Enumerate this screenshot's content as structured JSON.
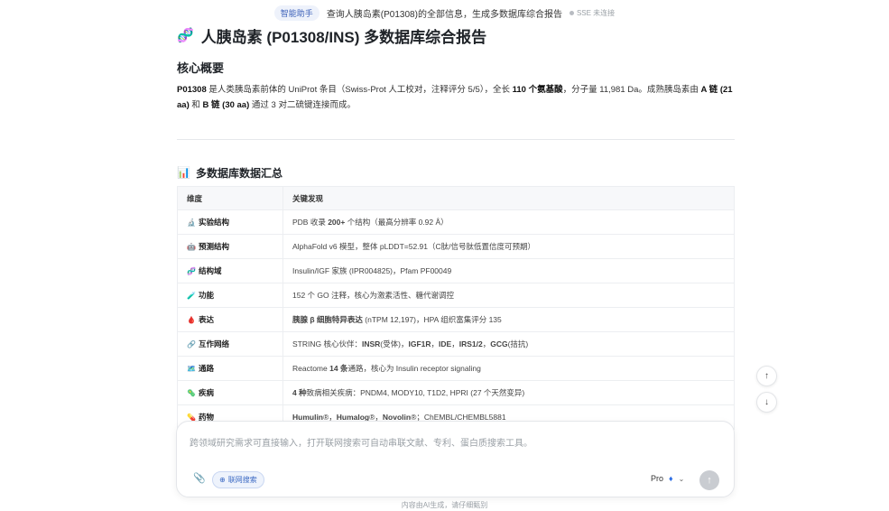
{
  "topbar": {
    "badge": "智能助手",
    "query": "查询人胰岛素(P01308)的全部信息，生成多数据库综合报告",
    "status": "SSE 未连接"
  },
  "report": {
    "title": "人胰岛素 (P01308/INS) 多数据库综合报告",
    "summary_heading": "核心概要",
    "summary": {
      "id": "P01308",
      "t1": " 是人类胰岛素前体的 UniProt 条目（Swiss-Prot 人工校对，注释评分 5/5），全长 ",
      "len": "110 个氨基酸",
      "t2": "，分子量 11,981 Da。成熟胰岛素由 ",
      "chainA": "A 链 (21 aa)",
      "t3": " 和 ",
      "chainB": "B 链 (30 aa)",
      "t4": " 通过 3 对二硫键连接而成。"
    },
    "table_heading": "多数据库数据汇总",
    "table": {
      "headers": [
        "维度",
        "关键发现"
      ],
      "rows": [
        {
          "icon": "🔬",
          "dim": "实验结构",
          "pre": "PDB 收录 ",
          "bold": "200+",
          "post": " 个结构（最高分辨率 0.92 Å）"
        },
        {
          "icon": "🤖",
          "dim": "预测结构",
          "pre": "AlphaFold v6 模型，整体 pLDDT=52.91（C肽/信号肽低置信度可预期）",
          "bold": "",
          "post": ""
        },
        {
          "icon": "🧬",
          "dim": "结构域",
          "pre": "Insulin/IGF 家族 (IPR004825)，Pfam PF00049",
          "bold": "",
          "post": ""
        },
        {
          "icon": "🧪",
          "dim": "功能",
          "pre": "152 个 GO 注释，核心为激素活性、糖代谢调控",
          "bold": "",
          "post": ""
        },
        {
          "icon": "🩸",
          "dim": "表达",
          "pre": "",
          "bold": "胰腺 β 细胞特异表达",
          "post": " (nTPM 12,197)，HPA 组织富集评分 135"
        },
        {
          "icon": "🔗",
          "dim": "互作网络",
          "pre": "STRING 核心伙伴：",
          "bold": "INSR",
          "post": "(受体)，",
          "bold2": "IGF1R",
          "mid2": "，",
          "bold3": "IDE",
          "mid3": "，",
          "bold4": "IRS1/2",
          "mid4": "，",
          "bold5": "GCG",
          "post2": "(拮抗)"
        },
        {
          "icon": "🗺️",
          "dim": "通路",
          "pre": "Reactome ",
          "bold": "14 条",
          "post": "通路，核心为 Insulin receptor signaling"
        },
        {
          "icon": "🦠",
          "dim": "疾病",
          "pre": "",
          "bold": "4 种",
          "post": "致病相关疾病：PNDM4, MODY10, T1D2, HPRI (27 个天然变异)"
        },
        {
          "icon": "💊",
          "dim": "药物",
          "pre": "",
          "bold": "Humulin",
          "post": "®，",
          "bold2": "Humalog",
          "mid2": "®，",
          "bold3": "Novolin",
          "post2": "®；ChEMBL/CHEMBL5881"
        }
      ]
    }
  },
  "input": {
    "placeholder": "跨领域研究需求可直接输入，打开联网搜索可自动串联文献、专利、蛋白质搜索工具。",
    "web_search_label": "联网搜索",
    "model_label": "Pro"
  },
  "footer": "内容由AI生成，请仔细甄别",
  "icons": {
    "title": "dna-icon",
    "table_heading": "bar-chart-icon",
    "scroll_up": "arrow-up-icon",
    "scroll_down": "arrow-down-icon",
    "attach": "paperclip-icon",
    "web": "globe-icon",
    "send": "send-icon"
  },
  "colors": {
    "badge_text": "#3a5fb8",
    "web_button": "#3d6bc4",
    "send_disabled": "#c9ccd1"
  }
}
